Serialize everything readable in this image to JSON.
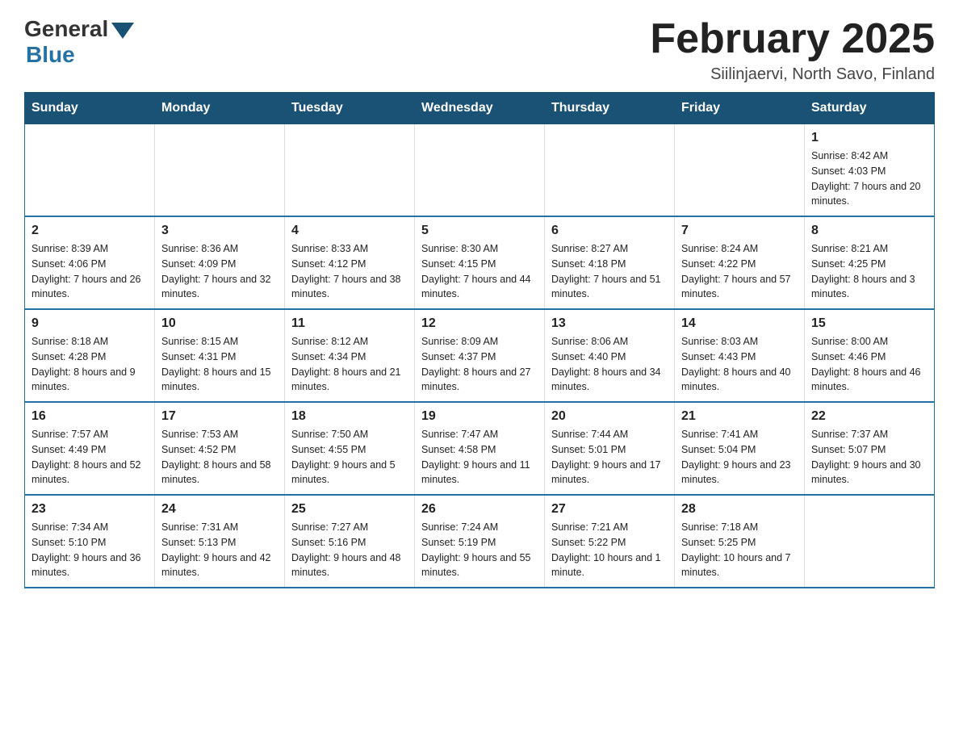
{
  "header": {
    "logo_general": "General",
    "logo_blue": "Blue",
    "month_title": "February 2025",
    "location": "Siilinjaervi, North Savo, Finland"
  },
  "days_of_week": [
    "Sunday",
    "Monday",
    "Tuesday",
    "Wednesday",
    "Thursday",
    "Friday",
    "Saturday"
  ],
  "weeks": [
    [
      {
        "day": "",
        "sunrise": "",
        "sunset": "",
        "daylight": ""
      },
      {
        "day": "",
        "sunrise": "",
        "sunset": "",
        "daylight": ""
      },
      {
        "day": "",
        "sunrise": "",
        "sunset": "",
        "daylight": ""
      },
      {
        "day": "",
        "sunrise": "",
        "sunset": "",
        "daylight": ""
      },
      {
        "day": "",
        "sunrise": "",
        "sunset": "",
        "daylight": ""
      },
      {
        "day": "",
        "sunrise": "",
        "sunset": "",
        "daylight": ""
      },
      {
        "day": "1",
        "sunrise": "Sunrise: 8:42 AM",
        "sunset": "Sunset: 4:03 PM",
        "daylight": "Daylight: 7 hours and 20 minutes."
      }
    ],
    [
      {
        "day": "2",
        "sunrise": "Sunrise: 8:39 AM",
        "sunset": "Sunset: 4:06 PM",
        "daylight": "Daylight: 7 hours and 26 minutes."
      },
      {
        "day": "3",
        "sunrise": "Sunrise: 8:36 AM",
        "sunset": "Sunset: 4:09 PM",
        "daylight": "Daylight: 7 hours and 32 minutes."
      },
      {
        "day": "4",
        "sunrise": "Sunrise: 8:33 AM",
        "sunset": "Sunset: 4:12 PM",
        "daylight": "Daylight: 7 hours and 38 minutes."
      },
      {
        "day": "5",
        "sunrise": "Sunrise: 8:30 AM",
        "sunset": "Sunset: 4:15 PM",
        "daylight": "Daylight: 7 hours and 44 minutes."
      },
      {
        "day": "6",
        "sunrise": "Sunrise: 8:27 AM",
        "sunset": "Sunset: 4:18 PM",
        "daylight": "Daylight: 7 hours and 51 minutes."
      },
      {
        "day": "7",
        "sunrise": "Sunrise: 8:24 AM",
        "sunset": "Sunset: 4:22 PM",
        "daylight": "Daylight: 7 hours and 57 minutes."
      },
      {
        "day": "8",
        "sunrise": "Sunrise: 8:21 AM",
        "sunset": "Sunset: 4:25 PM",
        "daylight": "Daylight: 8 hours and 3 minutes."
      }
    ],
    [
      {
        "day": "9",
        "sunrise": "Sunrise: 8:18 AM",
        "sunset": "Sunset: 4:28 PM",
        "daylight": "Daylight: 8 hours and 9 minutes."
      },
      {
        "day": "10",
        "sunrise": "Sunrise: 8:15 AM",
        "sunset": "Sunset: 4:31 PM",
        "daylight": "Daylight: 8 hours and 15 minutes."
      },
      {
        "day": "11",
        "sunrise": "Sunrise: 8:12 AM",
        "sunset": "Sunset: 4:34 PM",
        "daylight": "Daylight: 8 hours and 21 minutes."
      },
      {
        "day": "12",
        "sunrise": "Sunrise: 8:09 AM",
        "sunset": "Sunset: 4:37 PM",
        "daylight": "Daylight: 8 hours and 27 minutes."
      },
      {
        "day": "13",
        "sunrise": "Sunrise: 8:06 AM",
        "sunset": "Sunset: 4:40 PM",
        "daylight": "Daylight: 8 hours and 34 minutes."
      },
      {
        "day": "14",
        "sunrise": "Sunrise: 8:03 AM",
        "sunset": "Sunset: 4:43 PM",
        "daylight": "Daylight: 8 hours and 40 minutes."
      },
      {
        "day": "15",
        "sunrise": "Sunrise: 8:00 AM",
        "sunset": "Sunset: 4:46 PM",
        "daylight": "Daylight: 8 hours and 46 minutes."
      }
    ],
    [
      {
        "day": "16",
        "sunrise": "Sunrise: 7:57 AM",
        "sunset": "Sunset: 4:49 PM",
        "daylight": "Daylight: 8 hours and 52 minutes."
      },
      {
        "day": "17",
        "sunrise": "Sunrise: 7:53 AM",
        "sunset": "Sunset: 4:52 PM",
        "daylight": "Daylight: 8 hours and 58 minutes."
      },
      {
        "day": "18",
        "sunrise": "Sunrise: 7:50 AM",
        "sunset": "Sunset: 4:55 PM",
        "daylight": "Daylight: 9 hours and 5 minutes."
      },
      {
        "day": "19",
        "sunrise": "Sunrise: 7:47 AM",
        "sunset": "Sunset: 4:58 PM",
        "daylight": "Daylight: 9 hours and 11 minutes."
      },
      {
        "day": "20",
        "sunrise": "Sunrise: 7:44 AM",
        "sunset": "Sunset: 5:01 PM",
        "daylight": "Daylight: 9 hours and 17 minutes."
      },
      {
        "day": "21",
        "sunrise": "Sunrise: 7:41 AM",
        "sunset": "Sunset: 5:04 PM",
        "daylight": "Daylight: 9 hours and 23 minutes."
      },
      {
        "day": "22",
        "sunrise": "Sunrise: 7:37 AM",
        "sunset": "Sunset: 5:07 PM",
        "daylight": "Daylight: 9 hours and 30 minutes."
      }
    ],
    [
      {
        "day": "23",
        "sunrise": "Sunrise: 7:34 AM",
        "sunset": "Sunset: 5:10 PM",
        "daylight": "Daylight: 9 hours and 36 minutes."
      },
      {
        "day": "24",
        "sunrise": "Sunrise: 7:31 AM",
        "sunset": "Sunset: 5:13 PM",
        "daylight": "Daylight: 9 hours and 42 minutes."
      },
      {
        "day": "25",
        "sunrise": "Sunrise: 7:27 AM",
        "sunset": "Sunset: 5:16 PM",
        "daylight": "Daylight: 9 hours and 48 minutes."
      },
      {
        "day": "26",
        "sunrise": "Sunrise: 7:24 AM",
        "sunset": "Sunset: 5:19 PM",
        "daylight": "Daylight: 9 hours and 55 minutes."
      },
      {
        "day": "27",
        "sunrise": "Sunrise: 7:21 AM",
        "sunset": "Sunset: 5:22 PM",
        "daylight": "Daylight: 10 hours and 1 minute."
      },
      {
        "day": "28",
        "sunrise": "Sunrise: 7:18 AM",
        "sunset": "Sunset: 5:25 PM",
        "daylight": "Daylight: 10 hours and 7 minutes."
      },
      {
        "day": "",
        "sunrise": "",
        "sunset": "",
        "daylight": ""
      }
    ]
  ]
}
